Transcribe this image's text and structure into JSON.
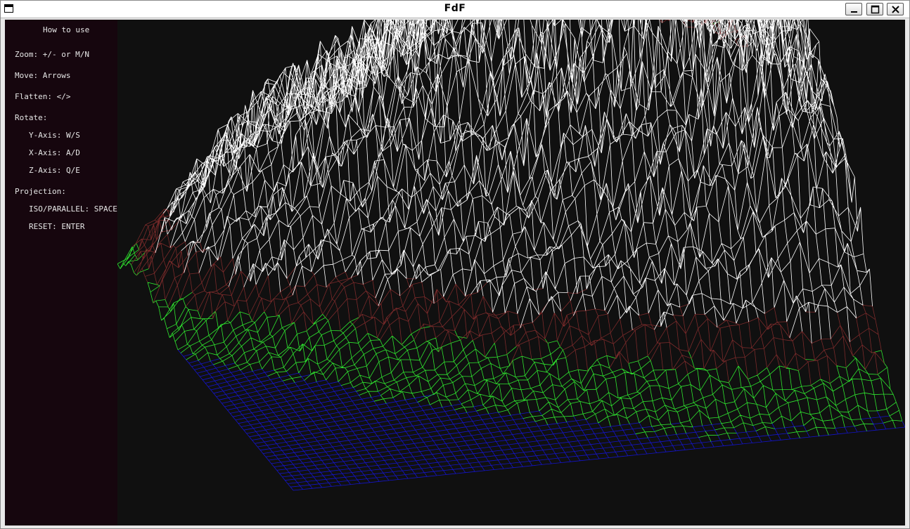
{
  "window": {
    "title": "FdF"
  },
  "controls": {
    "minimize": "minimize",
    "maximize": "maximize",
    "close": "close"
  },
  "help": {
    "heading": "How to use",
    "zoom": "Zoom: +/- or M/N",
    "move": "Move: Arrows",
    "flatten": "Flatten: </>",
    "rotate": "Rotate:",
    "y_axis": "Y-Axis: W/S",
    "x_axis": "X-Axis: A/D",
    "z_axis": "Z-Axis: Q/E",
    "projection": "Projection:",
    "iso_parallel": "ISO/PARALLEL: SPACE",
    "reset": "RESET: ENTER"
  },
  "colors": {
    "background": "#101010",
    "sidebar": "#16060e",
    "water": "#1414c8",
    "land": "#2fe62f",
    "rock": "#7a2a2a",
    "snow": "#ffffff"
  }
}
